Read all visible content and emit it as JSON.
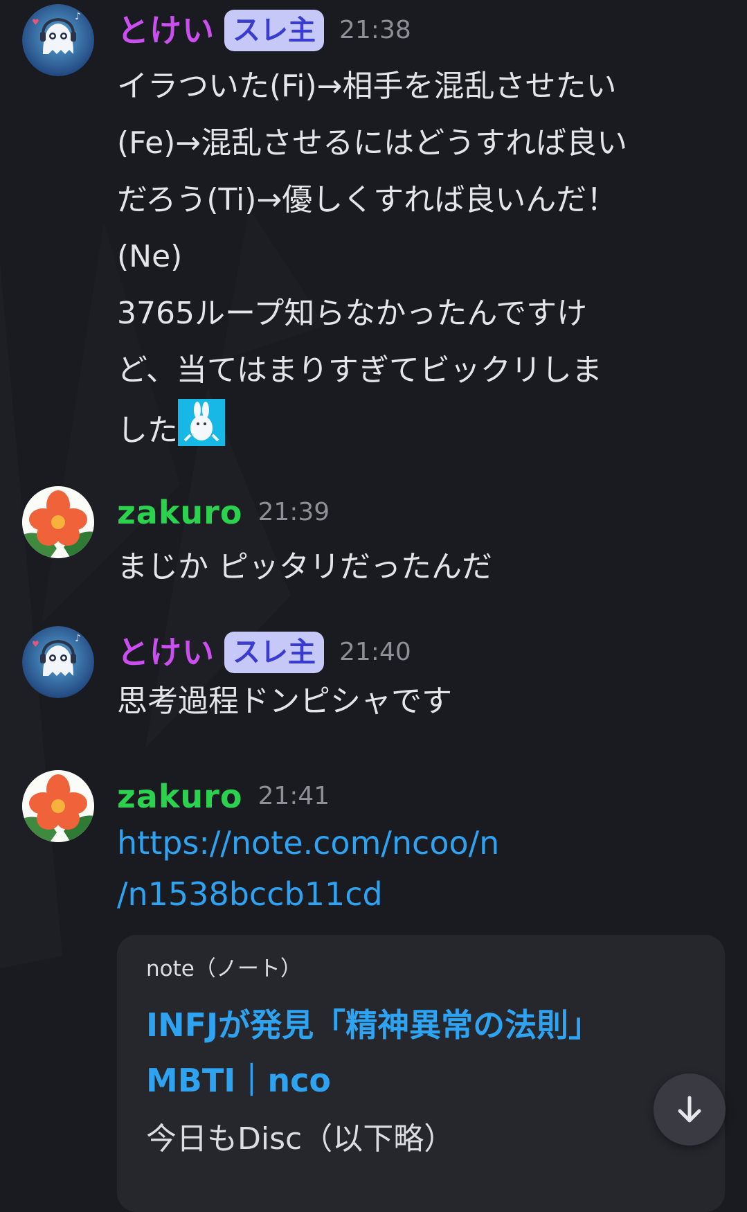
{
  "messages": [
    {
      "user": "とけい",
      "badge": "スレ主",
      "time": "21:38",
      "paragraphs": [
        "イラついた(Fi)→相手を混乱させたい\n(Fe)→混乱させるにはどうすれば良い\nだろう(Ti)→優しくすれば良いんだ！\n(Ne)",
        "3765ループ知らなかったんですけ\nど、当てはまりすぎてビックリしま\nした"
      ],
      "emoji": "rabbit-emoji"
    },
    {
      "user": "zakuro",
      "time": "21:39",
      "text": "まじか ピッタリだったんだ"
    },
    {
      "user": "とけい",
      "badge": "スレ主",
      "time": "21:40",
      "text": "思考過程ドンピシャです"
    },
    {
      "user": "zakuro",
      "time": "21:41",
      "link": "https://note.com/ncoo/n\n/n1538bccb11cd",
      "embed": {
        "provider": "note（ノート）",
        "title": "INFJが発見「精神異常の法則」\nMBTI｜nco",
        "description": "今日もDisc（以下略）"
      }
    }
  ],
  "icons": {
    "scroll_down": "arrow-down-icon"
  },
  "colors": {
    "background": "#1a1b20",
    "tokei_name": "#cb4ff0",
    "zakuro_name": "#2bd24e",
    "badge_bg": "#c6c8f8",
    "badge_text": "#3a3cd0",
    "link": "#2ea3f2"
  }
}
